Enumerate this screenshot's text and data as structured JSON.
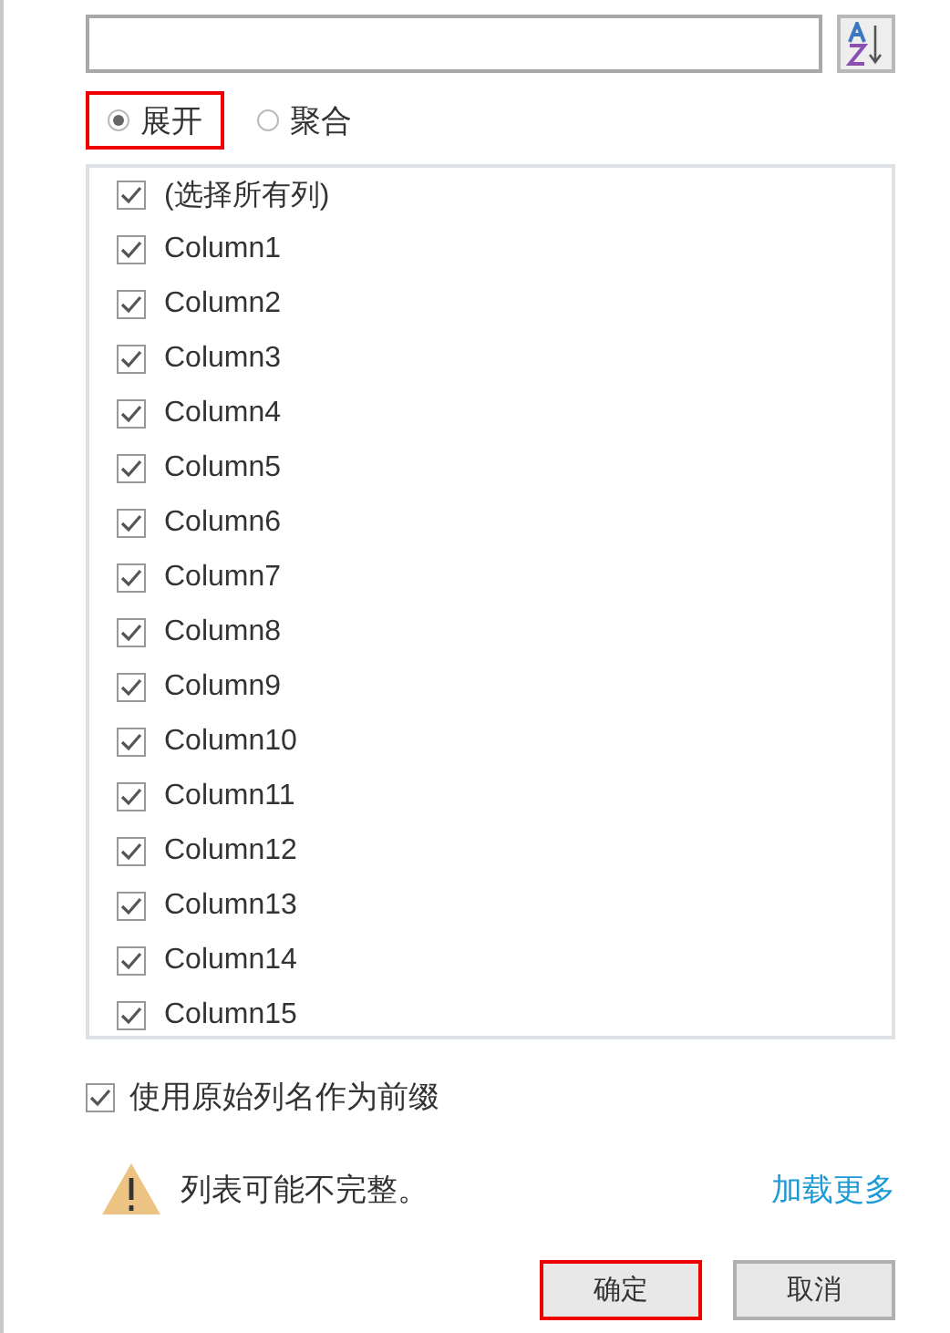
{
  "modes": [
    {
      "label": "展开",
      "selected": true,
      "highlighted": true
    },
    {
      "label": "聚合",
      "selected": false,
      "highlighted": false
    }
  ],
  "columns": [
    {
      "label": "(选择所有列)",
      "checked": true
    },
    {
      "label": "Column1",
      "checked": true
    },
    {
      "label": "Column2",
      "checked": true
    },
    {
      "label": "Column3",
      "checked": true
    },
    {
      "label": "Column4",
      "checked": true
    },
    {
      "label": "Column5",
      "checked": true
    },
    {
      "label": "Column6",
      "checked": true
    },
    {
      "label": "Column7",
      "checked": true
    },
    {
      "label": "Column8",
      "checked": true
    },
    {
      "label": "Column9",
      "checked": true
    },
    {
      "label": "Column10",
      "checked": true
    },
    {
      "label": "Column11",
      "checked": true
    },
    {
      "label": "Column12",
      "checked": true
    },
    {
      "label": "Column13",
      "checked": true
    },
    {
      "label": "Column14",
      "checked": true
    },
    {
      "label": "Column15",
      "checked": true
    }
  ],
  "prefix_option": {
    "label": "使用原始列名作为前缀",
    "checked": true
  },
  "warning": {
    "text": "列表可能不完整。",
    "link": "加载更多"
  },
  "buttons": [
    {
      "label": "确定",
      "highlighted": true
    },
    {
      "label": "取消",
      "highlighted": false
    }
  ]
}
